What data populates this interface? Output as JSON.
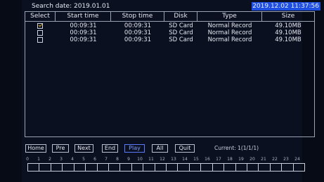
{
  "header": {
    "search_date": "Search date: 2019.01.01",
    "clock": "2019.12.02 11:37:56"
  },
  "table": {
    "columns": [
      "Select",
      "Start time",
      "Stop time",
      "Disk",
      "Type",
      "Size"
    ],
    "rows": [
      {
        "checked": true,
        "start": "00:09:31",
        "stop": "00:09:31",
        "disk": "SD Card",
        "type": "Normal Record",
        "size": "49.10MB"
      },
      {
        "checked": false,
        "start": "00:09:31",
        "stop": "00:09:31",
        "disk": "SD Card",
        "type": "Normal Record",
        "size": "49.10MB"
      },
      {
        "checked": false,
        "start": "00:09:31",
        "stop": "00:09:31",
        "disk": "SD Card",
        "type": "Normal Record",
        "size": "49.10MB"
      }
    ]
  },
  "controls": {
    "first": "Home",
    "prev": "Pre",
    "next": "Next",
    "end": "End",
    "play": "Play",
    "all": "All",
    "quit": "Quit",
    "current": "Current: 1(1/1/1)"
  },
  "timeline": {
    "hours": [
      "0",
      "1",
      "2",
      "3",
      "4",
      "5",
      "6",
      "7",
      "8",
      "9",
      "10",
      "11",
      "12",
      "13",
      "14",
      "15",
      "16",
      "17",
      "18",
      "19",
      "20",
      "21",
      "22",
      "23",
      "24"
    ]
  },
  "colors": {
    "background": "#070b16",
    "clock_bg": "#1f4fe0",
    "checkmark": "#e8b020",
    "active_button": "#7f9cff"
  }
}
